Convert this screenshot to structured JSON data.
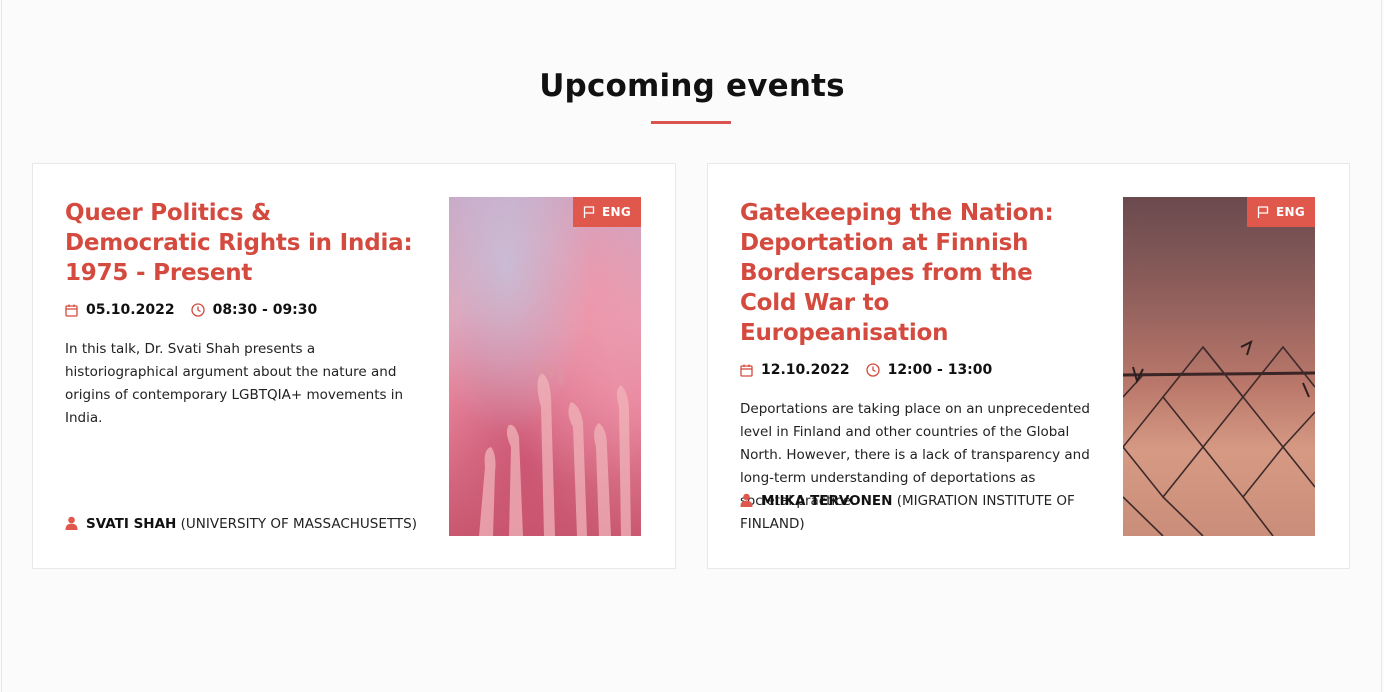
{
  "section": {
    "title": "Upcoming events"
  },
  "colors": {
    "accent": "#d44a3e",
    "badge": "#e0584b"
  },
  "events": [
    {
      "title": "Queer Politics & Democratic Rights in India: 1975 - Present",
      "date": "05.10.2022",
      "time": "08:30 - 09:30",
      "description": "In this talk, Dr. Svati Shah presents a historiographical argument about the nature and origins of contemporary LGBTQIA+ movements in India.",
      "speaker_name": "SVATI SHAH",
      "speaker_affiliation": "(UNIVERSITY OF MASSACHUSETTS)",
      "language": "ENG",
      "icons": {
        "date": "calendar-icon",
        "time": "clock-icon",
        "speaker": "person-icon",
        "language": "flag-icon"
      }
    },
    {
      "title": "Gatekeeping the Nation: Deportation at Finnish Borderscapes from the Cold War to Europeanisation",
      "date": "12.10.2022",
      "time": "12:00 - 13:00",
      "description": "Deportations are taking place on an unprecedented level in Finland and other countries of the Global North. However, there is a lack of transparency and long-term understanding of deportations as societal practice.",
      "speaker_name": "MIIKA TERVONEN",
      "speaker_affiliation": "(MIGRATION INSTITUTE OF FINLAND)",
      "language": "ENG",
      "icons": {
        "date": "calendar-icon",
        "time": "clock-icon",
        "speaker": "person-icon",
        "language": "flag-icon"
      }
    }
  ]
}
